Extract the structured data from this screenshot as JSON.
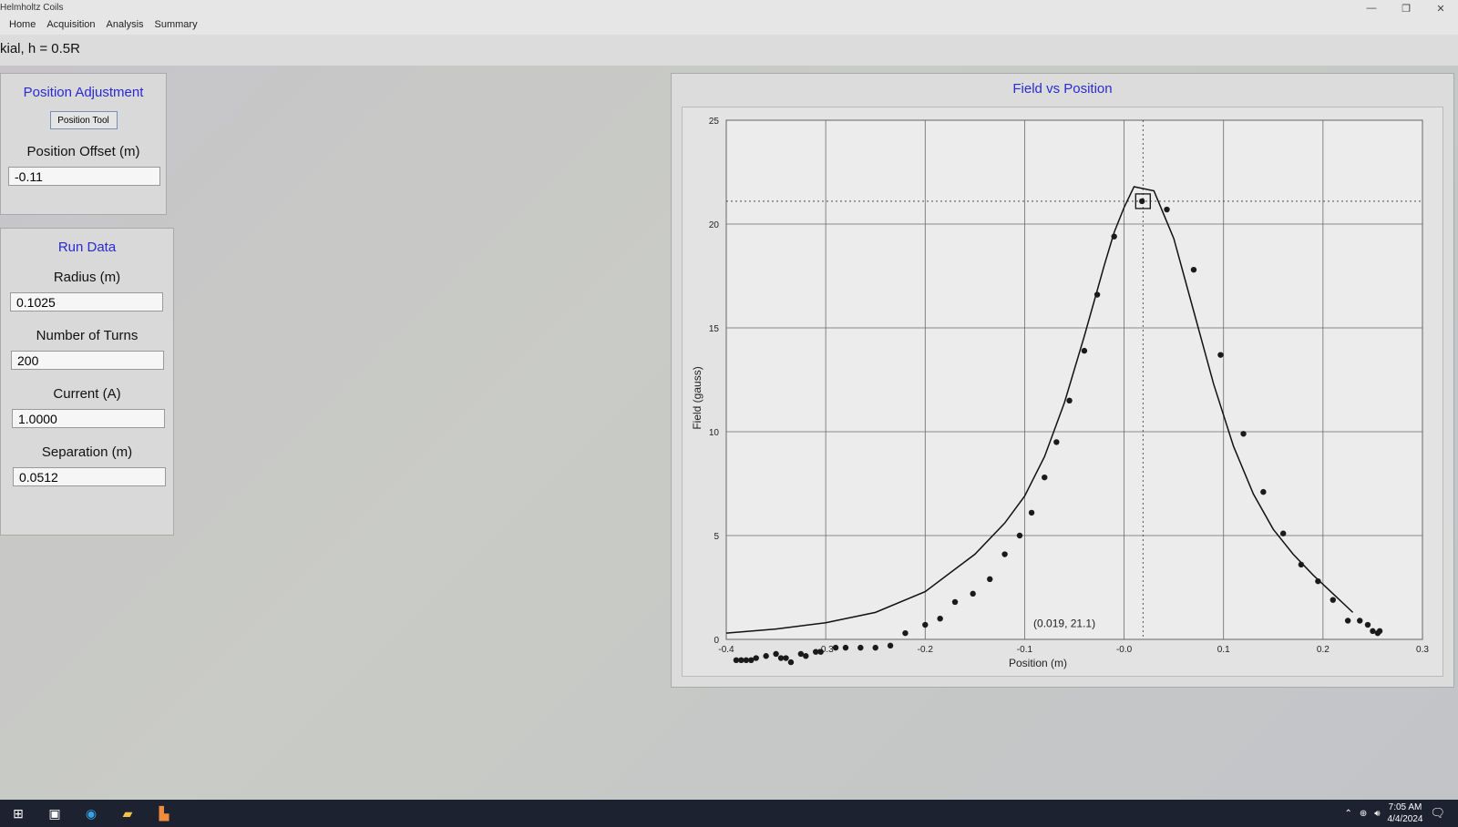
{
  "window": {
    "title": "Helmholtz Coils",
    "minimize": "—",
    "restore": "❐",
    "close": "✕"
  },
  "menu": [
    "Home",
    "Acquisition",
    "Analysis",
    "Summary"
  ],
  "subtitle": "kial, h = 0.5R",
  "position_panel": {
    "title": "Position Adjustment",
    "tool_button": "Position Tool",
    "offset_label": "Position Offset (m)",
    "offset_value": "-0.11"
  },
  "run_panel": {
    "title": "Run Data",
    "radius_label": "Radius (m)",
    "radius_value": "0.1025",
    "turns_label": "Number of Turns",
    "turns_value": "200",
    "current_label": "Current (A)",
    "current_value": "1.0000",
    "separation_label": "Separation (m)",
    "separation_value": "0.0512"
  },
  "chart": {
    "title": "Field vs Position",
    "cursor_readout": "(0.019, 21.1)"
  },
  "chart_data": {
    "type": "scatter",
    "title": "Field vs Position",
    "xlabel": "Position (m)",
    "ylabel": "Field (gauss)",
    "xlim": [
      -0.4,
      0.3
    ],
    "ylim": [
      0,
      25
    ],
    "xticks": [
      -0.4,
      -0.3,
      -0.2,
      -0.1,
      0.0,
      0.1,
      0.2,
      0.3
    ],
    "xtick_labels": [
      "-0.4",
      "-0.3",
      "-0.2",
      "-0.1",
      "-0.0",
      "0.1",
      "0.2",
      "0.3"
    ],
    "yticks": [
      0,
      5,
      10,
      15,
      20,
      25
    ],
    "ytick_labels": [
      "0",
      "5",
      "10",
      "15",
      "20",
      "25"
    ],
    "grid": true,
    "cursor": {
      "x": 0.019,
      "y": 21.1
    },
    "series": [
      {
        "kind": "points",
        "x": [
          -0.39,
          -0.385,
          -0.38,
          -0.375,
          -0.37,
          -0.36,
          -0.35,
          -0.345,
          -0.34,
          -0.335,
          -0.325,
          -0.32,
          -0.31,
          -0.305,
          -0.29,
          -0.28,
          -0.265,
          -0.25,
          -0.235,
          -0.22,
          -0.2,
          -0.185,
          -0.17,
          -0.152,
          -0.135,
          -0.12,
          -0.105,
          -0.093,
          -0.08,
          -0.068,
          -0.055,
          -0.04,
          -0.027,
          -0.01,
          0.018,
          0.043,
          0.07,
          0.097,
          0.12,
          0.14,
          0.16,
          0.178,
          0.195,
          0.21,
          0.225,
          0.237,
          0.245,
          0.25,
          0.255,
          0.257
        ],
        "y": [
          -1.0,
          -1.0,
          -1.0,
          -1.0,
          -0.9,
          -0.8,
          -0.7,
          -0.9,
          -0.9,
          -1.1,
          -0.7,
          -0.8,
          -0.6,
          -0.6,
          -0.4,
          -0.4,
          -0.4,
          -0.4,
          -0.3,
          0.3,
          0.7,
          1.0,
          1.8,
          2.2,
          2.9,
          4.1,
          5.0,
          6.1,
          7.8,
          9.5,
          11.5,
          13.9,
          16.6,
          19.4,
          21.1,
          20.7,
          17.8,
          13.7,
          9.9,
          7.1,
          5.1,
          3.6,
          2.8,
          1.9,
          0.9,
          0.9,
          0.7,
          0.4,
          0.3,
          0.4
        ]
      },
      {
        "kind": "line",
        "x": [
          -0.4,
          -0.35,
          -0.3,
          -0.25,
          -0.2,
          -0.15,
          -0.12,
          -0.1,
          -0.08,
          -0.06,
          -0.04,
          -0.02,
          -0.01,
          0.0,
          0.01,
          0.03,
          0.05,
          0.07,
          0.09,
          0.11,
          0.13,
          0.15,
          0.17,
          0.19,
          0.21,
          0.23
        ],
        "y": [
          0.3,
          0.5,
          0.8,
          1.3,
          2.3,
          4.1,
          5.6,
          6.9,
          8.8,
          11.4,
          14.6,
          18.0,
          19.6,
          20.8,
          21.8,
          21.6,
          19.3,
          15.8,
          12.3,
          9.3,
          7.0,
          5.3,
          4.1,
          3.1,
          2.2,
          1.3
        ]
      }
    ]
  },
  "taskbar": {
    "time": "7:05 AM",
    "date": "4/4/2024"
  }
}
